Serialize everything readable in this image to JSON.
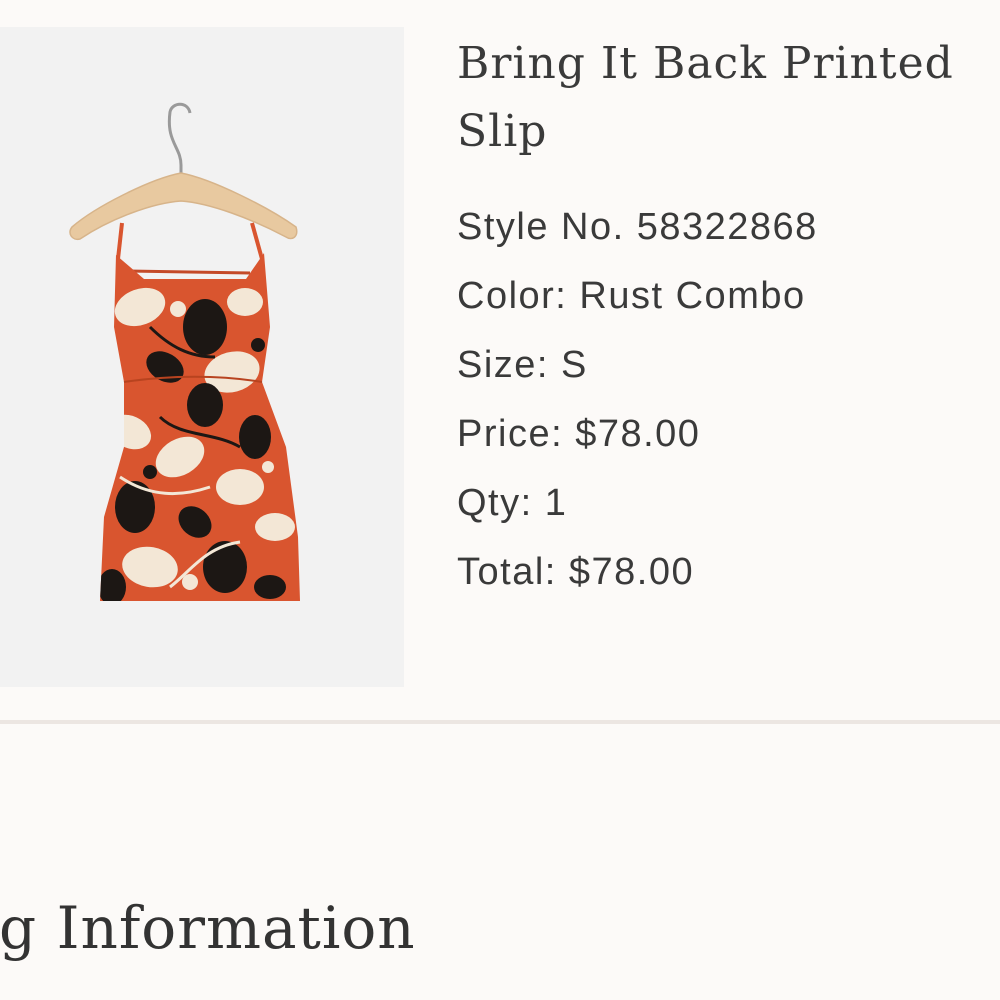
{
  "product": {
    "title": "Bring It Back Printed Slip",
    "image_alt": "Rust floral print slip dress on a wooden hanger",
    "details": [
      {
        "label": "Style No.",
        "value": "58322868",
        "text": "Style No. 58322868"
      },
      {
        "label": "Color:",
        "value": "Rust Combo",
        "text": "Color: Rust Combo"
      },
      {
        "label": "Size:",
        "value": "S",
        "text": "Size: S"
      },
      {
        "label": "Price:",
        "value": "$78.00",
        "text": "Price: $78.00"
      },
      {
        "label": "Qty:",
        "value": "1",
        "text": "Qty: 1"
      },
      {
        "label": "Total:",
        "value": "$78.00",
        "text": "Total: $78.00"
      }
    ]
  },
  "section": {
    "heading": "lling Information"
  },
  "colors": {
    "background": "#fcfaf8",
    "text": "#3a3a3a",
    "divider": "#ece6e2",
    "dress_rust": "#d9552f",
    "print_cream": "#f3e7d6",
    "print_black": "#1c1714",
    "hanger_wood": "#e8c9a0"
  }
}
